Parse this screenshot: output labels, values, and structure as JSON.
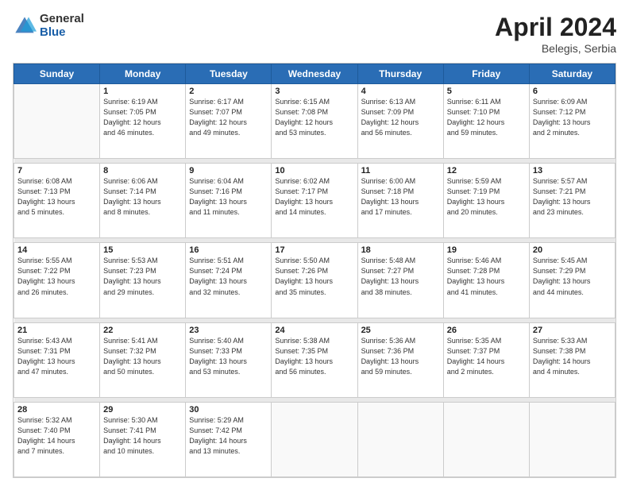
{
  "header": {
    "logo_general": "General",
    "logo_blue": "Blue",
    "month_year": "April 2024",
    "location": "Belegis, Serbia"
  },
  "weekdays": [
    "Sunday",
    "Monday",
    "Tuesday",
    "Wednesday",
    "Thursday",
    "Friday",
    "Saturday"
  ],
  "weeks": [
    [
      {
        "day": "",
        "info": ""
      },
      {
        "day": "1",
        "info": "Sunrise: 6:19 AM\nSunset: 7:05 PM\nDaylight: 12 hours\nand 46 minutes."
      },
      {
        "day": "2",
        "info": "Sunrise: 6:17 AM\nSunset: 7:07 PM\nDaylight: 12 hours\nand 49 minutes."
      },
      {
        "day": "3",
        "info": "Sunrise: 6:15 AM\nSunset: 7:08 PM\nDaylight: 12 hours\nand 53 minutes."
      },
      {
        "day": "4",
        "info": "Sunrise: 6:13 AM\nSunset: 7:09 PM\nDaylight: 12 hours\nand 56 minutes."
      },
      {
        "day": "5",
        "info": "Sunrise: 6:11 AM\nSunset: 7:10 PM\nDaylight: 12 hours\nand 59 minutes."
      },
      {
        "day": "6",
        "info": "Sunrise: 6:09 AM\nSunset: 7:12 PM\nDaylight: 13 hours\nand 2 minutes."
      }
    ],
    [
      {
        "day": "7",
        "info": "Sunrise: 6:08 AM\nSunset: 7:13 PM\nDaylight: 13 hours\nand 5 minutes."
      },
      {
        "day": "8",
        "info": "Sunrise: 6:06 AM\nSunset: 7:14 PM\nDaylight: 13 hours\nand 8 minutes."
      },
      {
        "day": "9",
        "info": "Sunrise: 6:04 AM\nSunset: 7:16 PM\nDaylight: 13 hours\nand 11 minutes."
      },
      {
        "day": "10",
        "info": "Sunrise: 6:02 AM\nSunset: 7:17 PM\nDaylight: 13 hours\nand 14 minutes."
      },
      {
        "day": "11",
        "info": "Sunrise: 6:00 AM\nSunset: 7:18 PM\nDaylight: 13 hours\nand 17 minutes."
      },
      {
        "day": "12",
        "info": "Sunrise: 5:59 AM\nSunset: 7:19 PM\nDaylight: 13 hours\nand 20 minutes."
      },
      {
        "day": "13",
        "info": "Sunrise: 5:57 AM\nSunset: 7:21 PM\nDaylight: 13 hours\nand 23 minutes."
      }
    ],
    [
      {
        "day": "14",
        "info": "Sunrise: 5:55 AM\nSunset: 7:22 PM\nDaylight: 13 hours\nand 26 minutes."
      },
      {
        "day": "15",
        "info": "Sunrise: 5:53 AM\nSunset: 7:23 PM\nDaylight: 13 hours\nand 29 minutes."
      },
      {
        "day": "16",
        "info": "Sunrise: 5:51 AM\nSunset: 7:24 PM\nDaylight: 13 hours\nand 32 minutes."
      },
      {
        "day": "17",
        "info": "Sunrise: 5:50 AM\nSunset: 7:26 PM\nDaylight: 13 hours\nand 35 minutes."
      },
      {
        "day": "18",
        "info": "Sunrise: 5:48 AM\nSunset: 7:27 PM\nDaylight: 13 hours\nand 38 minutes."
      },
      {
        "day": "19",
        "info": "Sunrise: 5:46 AM\nSunset: 7:28 PM\nDaylight: 13 hours\nand 41 minutes."
      },
      {
        "day": "20",
        "info": "Sunrise: 5:45 AM\nSunset: 7:29 PM\nDaylight: 13 hours\nand 44 minutes."
      }
    ],
    [
      {
        "day": "21",
        "info": "Sunrise: 5:43 AM\nSunset: 7:31 PM\nDaylight: 13 hours\nand 47 minutes."
      },
      {
        "day": "22",
        "info": "Sunrise: 5:41 AM\nSunset: 7:32 PM\nDaylight: 13 hours\nand 50 minutes."
      },
      {
        "day": "23",
        "info": "Sunrise: 5:40 AM\nSunset: 7:33 PM\nDaylight: 13 hours\nand 53 minutes."
      },
      {
        "day": "24",
        "info": "Sunrise: 5:38 AM\nSunset: 7:35 PM\nDaylight: 13 hours\nand 56 minutes."
      },
      {
        "day": "25",
        "info": "Sunrise: 5:36 AM\nSunset: 7:36 PM\nDaylight: 13 hours\nand 59 minutes."
      },
      {
        "day": "26",
        "info": "Sunrise: 5:35 AM\nSunset: 7:37 PM\nDaylight: 14 hours\nand 2 minutes."
      },
      {
        "day": "27",
        "info": "Sunrise: 5:33 AM\nSunset: 7:38 PM\nDaylight: 14 hours\nand 4 minutes."
      }
    ],
    [
      {
        "day": "28",
        "info": "Sunrise: 5:32 AM\nSunset: 7:40 PM\nDaylight: 14 hours\nand 7 minutes."
      },
      {
        "day": "29",
        "info": "Sunrise: 5:30 AM\nSunset: 7:41 PM\nDaylight: 14 hours\nand 10 minutes."
      },
      {
        "day": "30",
        "info": "Sunrise: 5:29 AM\nSunset: 7:42 PM\nDaylight: 14 hours\nand 13 minutes."
      },
      {
        "day": "",
        "info": ""
      },
      {
        "day": "",
        "info": ""
      },
      {
        "day": "",
        "info": ""
      },
      {
        "day": "",
        "info": ""
      }
    ]
  ]
}
